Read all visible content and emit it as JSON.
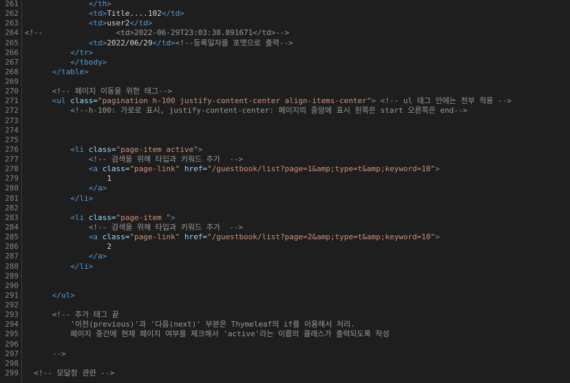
{
  "editor": {
    "lines": [
      {
        "n": "261",
        "indent": 14,
        "tokens": [
          {
            "c": "tag",
            "t": "</th>"
          }
        ]
      },
      {
        "n": "262",
        "indent": 14,
        "tokens": [
          {
            "c": "tag",
            "t": "<td>"
          },
          {
            "c": "txt",
            "t": "Title....102"
          },
          {
            "c": "tag",
            "t": "</td>"
          }
        ]
      },
      {
        "n": "263",
        "indent": 14,
        "tokens": [
          {
            "c": "tag",
            "t": "<td>"
          },
          {
            "c": "txt",
            "t": "user2"
          },
          {
            "c": "tag",
            "t": "</td>"
          }
        ]
      },
      {
        "n": "264",
        "indent": 0,
        "tokens": [
          {
            "c": "cmt",
            "t": "<!--                <td>2022-06-29T23:03:38.891671</td>-->"
          }
        ]
      },
      {
        "n": "265",
        "indent": 14,
        "tokens": [
          {
            "c": "tag",
            "t": "<td>"
          },
          {
            "c": "txt",
            "t": "2022/06/29"
          },
          {
            "c": "tag",
            "t": "</td>"
          },
          {
            "c": "cmt",
            "t": "<!--등록일자를 포맷으로 출력-->"
          }
        ]
      },
      {
        "n": "266",
        "indent": 10,
        "tokens": [
          {
            "c": "tag",
            "t": "</tr>"
          }
        ]
      },
      {
        "n": "267",
        "indent": 10,
        "tokens": [
          {
            "c": "tag",
            "t": "</tbody>"
          }
        ]
      },
      {
        "n": "268",
        "indent": 6,
        "tokens": [
          {
            "c": "tag",
            "t": "</table>"
          }
        ]
      },
      {
        "n": "269",
        "indent": 0,
        "tokens": []
      },
      {
        "n": "270",
        "indent": 6,
        "tokens": [
          {
            "c": "cmt",
            "t": "<!-- 페이지 이동을 위한 태그-->"
          }
        ]
      },
      {
        "n": "271",
        "indent": 6,
        "tokens": [
          {
            "c": "tag",
            "t": "<ul "
          },
          {
            "c": "attr",
            "t": "class="
          },
          {
            "c": "str",
            "t": "\"pagination h-100 justify-content-center align-items-center\""
          },
          {
            "c": "tag",
            "t": ">"
          },
          {
            "c": "txt",
            "t": " "
          },
          {
            "c": "cmt",
            "t": "<!-- ul 태그 안에는 전부 적용 -->"
          }
        ]
      },
      {
        "n": "272",
        "indent": 10,
        "tokens": [
          {
            "c": "cmt",
            "t": "<!--h-100: 가로로 표시, justify-content-center: 페이지의 중앙에 표시 왼쪽은 start 오른쪽은 end-->"
          }
        ]
      },
      {
        "n": "273",
        "indent": 0,
        "tokens": []
      },
      {
        "n": "274",
        "indent": 0,
        "tokens": []
      },
      {
        "n": "275",
        "indent": 0,
        "tokens": []
      },
      {
        "n": "276",
        "indent": 10,
        "tokens": [
          {
            "c": "tag",
            "t": "<li "
          },
          {
            "c": "attr",
            "t": "class="
          },
          {
            "c": "str",
            "t": "\"page-item active\""
          },
          {
            "c": "tag",
            "t": ">"
          }
        ]
      },
      {
        "n": "277",
        "indent": 14,
        "tokens": [
          {
            "c": "cmt",
            "t": "<!-- 검색을 위해 타입과 키워드 추가  -->"
          }
        ]
      },
      {
        "n": "278",
        "indent": 14,
        "tokens": [
          {
            "c": "tag",
            "t": "<a "
          },
          {
            "c": "attr",
            "t": "class="
          },
          {
            "c": "str",
            "t": "\"page-link\""
          },
          {
            "c": "txt",
            "t": " "
          },
          {
            "c": "attr",
            "t": "href="
          },
          {
            "c": "str",
            "t": "\"/guestbook/list?page=1&amp;type=t&amp;keyword=10\""
          },
          {
            "c": "tag",
            "t": ">"
          }
        ]
      },
      {
        "n": "279",
        "indent": 18,
        "tokens": [
          {
            "c": "txt",
            "t": "1"
          }
        ]
      },
      {
        "n": "280",
        "indent": 14,
        "tokens": [
          {
            "c": "tag",
            "t": "</a>"
          }
        ]
      },
      {
        "n": "281",
        "indent": 10,
        "tokens": [
          {
            "c": "tag",
            "t": "</li>"
          }
        ]
      },
      {
        "n": "282",
        "indent": 0,
        "tokens": []
      },
      {
        "n": "283",
        "indent": 10,
        "tokens": [
          {
            "c": "tag",
            "t": "<li "
          },
          {
            "c": "attr",
            "t": "class="
          },
          {
            "c": "str",
            "t": "\"page-item \""
          },
          {
            "c": "tag",
            "t": ">"
          }
        ]
      },
      {
        "n": "284",
        "indent": 14,
        "tokens": [
          {
            "c": "cmt",
            "t": "<!-- 검색을 위해 타입과 키워드 추가  -->"
          }
        ]
      },
      {
        "n": "285",
        "indent": 14,
        "tokens": [
          {
            "c": "tag",
            "t": "<a "
          },
          {
            "c": "attr",
            "t": "class="
          },
          {
            "c": "str",
            "t": "\"page-link\""
          },
          {
            "c": "txt",
            "t": " "
          },
          {
            "c": "attr",
            "t": "href="
          },
          {
            "c": "str",
            "t": "\"/guestbook/list?page=2&amp;type=t&amp;keyword=10\""
          },
          {
            "c": "tag",
            "t": ">"
          }
        ]
      },
      {
        "n": "286",
        "indent": 18,
        "tokens": [
          {
            "c": "txt",
            "t": "2"
          }
        ]
      },
      {
        "n": "287",
        "indent": 14,
        "tokens": [
          {
            "c": "tag",
            "t": "</a>"
          }
        ]
      },
      {
        "n": "288",
        "indent": 10,
        "tokens": [
          {
            "c": "tag",
            "t": "</li>"
          }
        ]
      },
      {
        "n": "289",
        "indent": 0,
        "tokens": []
      },
      {
        "n": "290",
        "indent": 0,
        "tokens": []
      },
      {
        "n": "291",
        "indent": 6,
        "tokens": [
          {
            "c": "tag",
            "t": "</ul>"
          }
        ]
      },
      {
        "n": "292",
        "indent": 0,
        "tokens": []
      },
      {
        "n": "293",
        "indent": 6,
        "tokens": [
          {
            "c": "cmt",
            "t": "<!-- 추가 태그 끝"
          }
        ]
      },
      {
        "n": "294",
        "indent": 10,
        "tokens": [
          {
            "c": "cmt",
            "t": "'이전(previous)'과 '다음(next)' 부분은 Thymeleaf의 if를 이용해서 처리."
          }
        ]
      },
      {
        "n": "295",
        "indent": 10,
        "tokens": [
          {
            "c": "cmt",
            "t": "페이지 중간에 현재 페이지 여부를 체크해서 'active'라는 이름의 클래스가 출력되도록 작성"
          }
        ]
      },
      {
        "n": "296",
        "indent": 0,
        "tokens": []
      },
      {
        "n": "297",
        "indent": 6,
        "tokens": [
          {
            "c": "cmt",
            "t": "-->"
          }
        ]
      },
      {
        "n": "298",
        "indent": 0,
        "tokens": []
      },
      {
        "n": "299",
        "indent": 2,
        "tokens": [
          {
            "c": "cmt",
            "t": "<!-- 모달창 관련 -->"
          }
        ]
      }
    ]
  }
}
